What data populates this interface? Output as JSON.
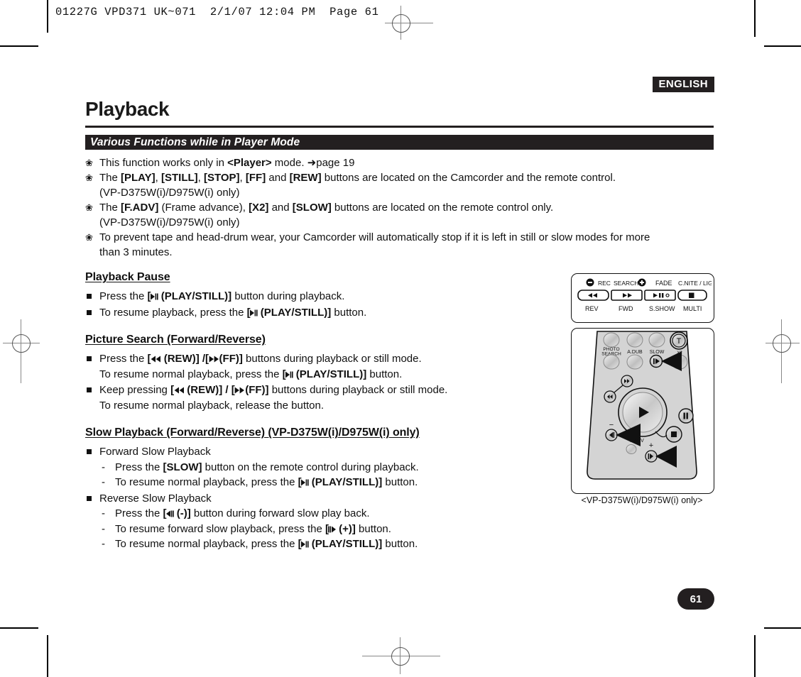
{
  "printer_header": "01227G VPD371 UK~071  2/1/07 12:04 PM  Page 61",
  "language_badge": "ENGLISH",
  "chapter_title": "Playback",
  "section_bar_title": "Various Functions while in Player Mode",
  "colors": {
    "ink": "#231f20",
    "paper": "#ffffff"
  },
  "notes": [
    {
      "bullet": "❀",
      "line1_a": "This function works only in ",
      "line1_b": "<Player>",
      "line1_c": " mode. ",
      "arrow": "➜",
      "line1_d": "page 19",
      "line2": ""
    },
    {
      "bullet": "❀",
      "text": "The [PLAY], [STILL], [STOP], [FF] and [REW] buttons are located on the Camcorder and the remote control.",
      "sub": "(VP-D375W(i)/D975W(i) only)"
    },
    {
      "bullet": "❀",
      "text": "The [F.ADV] (Frame advance), [X2] and [SLOW] buttons are located on the remote control only.",
      "sub": "(VP-D375W(i)/D975W(i) only)"
    },
    {
      "bullet": "❀",
      "text": "To prevent tape and head-drum wear, your Camcorder will automatically stop if it is left in still or slow modes for more",
      "sub": "than 3 minutes."
    }
  ],
  "sections": [
    {
      "heading": "Playback Pause",
      "items": [
        {
          "pre": "Press the ",
          "btn": "(PLAY/STILL)]",
          "post": " button during playback."
        },
        {
          "pre": "To resume playback, press the ",
          "btn": "(PLAY/STILL)]",
          "post": " button."
        }
      ]
    },
    {
      "heading": "Picture Search (Forward/Reverse)",
      "items": [
        {
          "pre": "Press the ",
          "btn": "(REW)] /",
          "btn2": "(FF)]",
          "post": " buttons during playback or still mode.",
          "cont_pre": "To resume normal playback, press the ",
          "cont_btn": "(PLAY/STILL)]",
          "cont_post": " button."
        },
        {
          "pre": "Keep pressing ",
          "btn": "(REW)] / ",
          "btn2": "(FF)]",
          "post": " buttons during playback or still mode.",
          "cont_pre": "To resume normal playback, release the button."
        }
      ]
    },
    {
      "heading": "Slow Playback (Forward/Reverse) (VP-D375W(i)/D975W(i) only)",
      "items": [
        {
          "label": "Forward Slow Playback",
          "subs": [
            {
              "pre": "Press the ",
              "btn_text": "[SLOW]",
              "post": " button on the remote control during playback."
            },
            {
              "pre": "To resume normal playback, press the ",
              "btn": "(PLAY/STILL)]",
              "post": " button."
            }
          ]
        },
        {
          "label": "Reverse Slow Playback",
          "subs": [
            {
              "pre": "Press the ",
              "btn": "(-)]",
              "post": " button during forward slow play back."
            },
            {
              "pre": "To resume forward slow playback, press the ",
              "btn": "(+)]",
              "post": " button."
            },
            {
              "pre": "To resume normal playback, press the ",
              "btn": "(PLAY/STILL)]",
              "post": " button."
            }
          ]
        }
      ]
    }
  ],
  "figure_camcorder": {
    "top_labels": [
      "REC",
      "SEARCH",
      "FADE",
      "C.NITE / LIGHT"
    ],
    "bottom_labels": [
      "REV",
      "FWD",
      "S.SHOW",
      "MULTI"
    ],
    "keys": [
      "rew-icon",
      "ff-icon",
      "play-still-icon",
      "stop-icon"
    ]
  },
  "figure_remote": {
    "labels": [
      "PHOTO SEARCH",
      "A.DUB",
      "SLOW",
      "X2",
      "T",
      "F.ADV"
    ],
    "signs": [
      "−",
      "+"
    ]
  },
  "figure_caption": "<VP-D375W(i)/D975W(i) only>",
  "page_number": "61"
}
